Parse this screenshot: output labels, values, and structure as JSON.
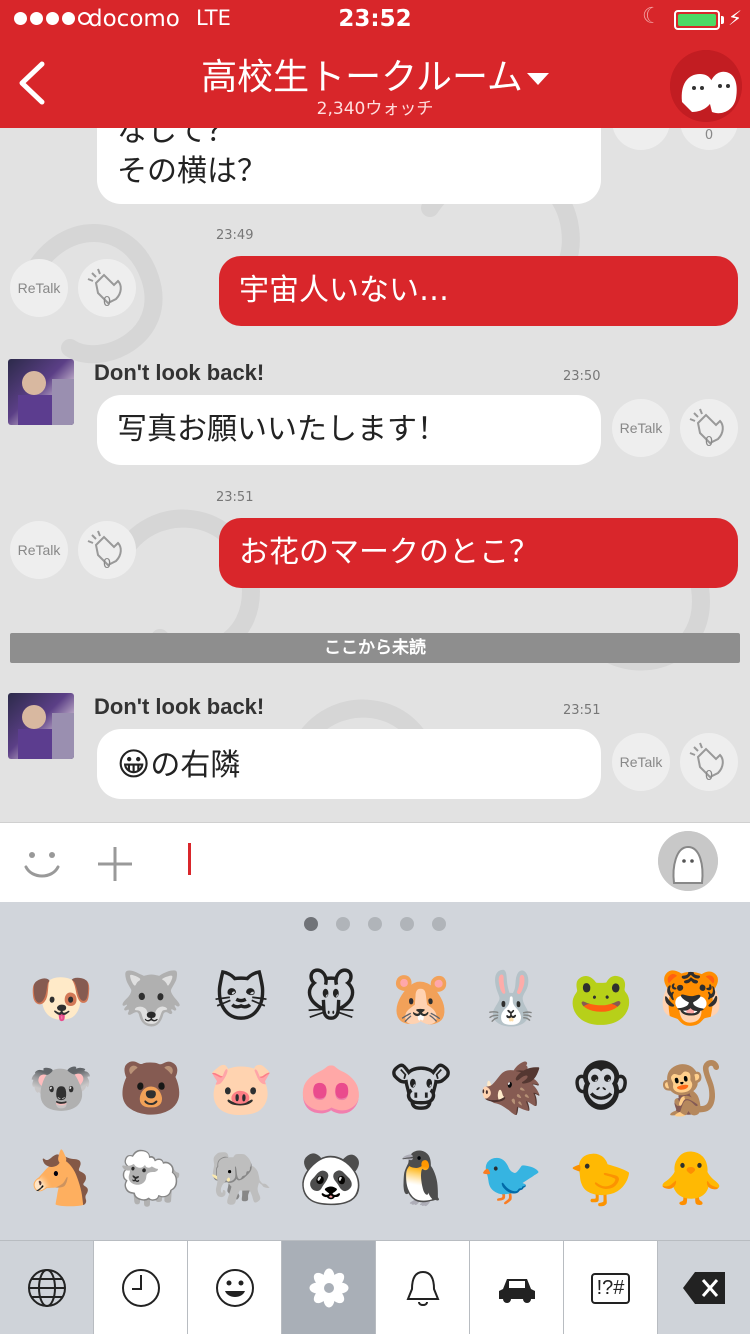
{
  "status": {
    "carrier": "docomo",
    "network": "LTE",
    "time": "23:52"
  },
  "header": {
    "title": "高校生トークルーム",
    "subtitle": "2,340ウォッチ"
  },
  "chat": {
    "unread_label": "ここから未読",
    "retalk_label": "ReTalk",
    "clap_count": "0",
    "messages": [
      {
        "type": "in",
        "text_line1": "なして？",
        "text_line2": "その横は？"
      },
      {
        "type": "out",
        "time": "23:49",
        "text": "宇宙人いない…"
      },
      {
        "type": "in",
        "sender": "Don't look back!",
        "time": "23:50",
        "text": "写真お願いいたします！"
      },
      {
        "type": "out",
        "time": "23:51",
        "text": "お花のマークのとこ？"
      },
      {
        "type": "in",
        "sender": "Don't look back!",
        "time": "23:51",
        "emoji": "😀",
        "text": "の右隣"
      }
    ]
  },
  "keyboard": {
    "page_count": 5,
    "active_page": 1,
    "emojis": [
      "🐶",
      "🐺",
      "🐱",
      "🐭",
      "🐹",
      "🐰",
      "🐸",
      "🐯",
      "🐨",
      "🐻",
      "🐷",
      "🐽",
      "🐮",
      "🐗",
      "🐵",
      "🐒",
      "🐴",
      "🐑",
      "🐘",
      "🐼",
      "🐧",
      "🐦",
      "🐤",
      "🐥"
    ],
    "tabs": [
      "globe-icon",
      "clock-icon",
      "smiley-icon",
      "flower-icon",
      "bell-icon",
      "car-icon",
      "symbols-icon",
      "delete-icon"
    ],
    "symbols_label": "!?#"
  },
  "colors": {
    "brand_red": "#d8262a",
    "bubble_out": "#d9262b",
    "battery_green": "#4cd964"
  }
}
